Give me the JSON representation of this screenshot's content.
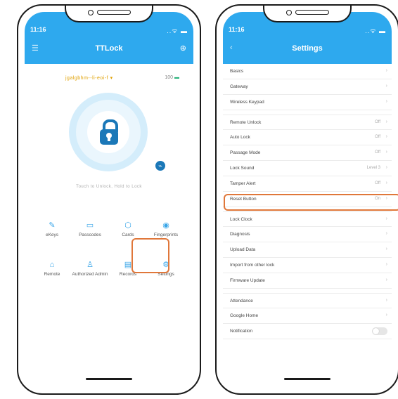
{
  "status": {
    "time": "11:16",
    "icons": "..ᯤ ▬"
  },
  "left_screen": {
    "title": "TTLock",
    "lock_name": "jgalgbhm--li-eoi-f  ▾",
    "battery": "100",
    "unlock_hint": "Touch to Unlock, Hold to Lock",
    "grid": [
      {
        "label": "eKeys",
        "icon": "✎"
      },
      {
        "label": "Passcodes",
        "icon": "▭"
      },
      {
        "label": "Cards",
        "icon": "⬡"
      },
      {
        "label": "Fingerprints",
        "icon": "◉"
      },
      {
        "label": "Remote",
        "icon": "⌂"
      },
      {
        "label": "Authorized Admin",
        "icon": "♙"
      },
      {
        "label": "Records",
        "icon": "▤"
      },
      {
        "label": "Settings",
        "icon": "⚙"
      }
    ]
  },
  "right_screen": {
    "title": "Settings",
    "rows": [
      {
        "label": "Basics",
        "value": ""
      },
      {
        "label": "Gateway",
        "value": ""
      },
      {
        "label": "Wireless Keypad",
        "value": ""
      },
      {
        "label": "Remote Unlock",
        "value": "Off",
        "gap": true
      },
      {
        "label": "Auto Lock",
        "value": "Off"
      },
      {
        "label": "Passage Mode",
        "value": "Off"
      },
      {
        "label": "Lock Sound",
        "value": "Level 3"
      },
      {
        "label": "Tamper Alert",
        "value": "Off"
      },
      {
        "label": "Reset Button",
        "value": "On"
      },
      {
        "label": "Lock Clock",
        "value": "",
        "gap": true
      },
      {
        "label": "Diagnosis",
        "value": ""
      },
      {
        "label": "Upload Data",
        "value": ""
      },
      {
        "label": "Import from other lock",
        "value": ""
      },
      {
        "label": "Firmware Update",
        "value": ""
      },
      {
        "label": "Attendance",
        "value": "",
        "gap": true
      },
      {
        "label": "Google Home",
        "value": ""
      },
      {
        "label": "Notification",
        "value": "",
        "toggle": true
      }
    ]
  },
  "colors": {
    "header": "#2ea9ee",
    "highlight": "#e0773a",
    "lock": "#1b78b8"
  }
}
